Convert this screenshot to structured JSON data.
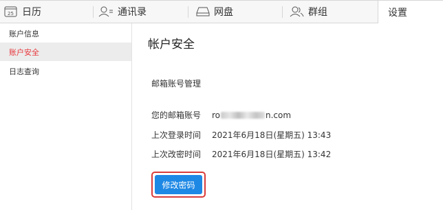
{
  "tabs": [
    {
      "label": "日历",
      "icon": "calendar-icon",
      "icon_text": "25"
    },
    {
      "label": "通讯录",
      "icon": "contacts-icon"
    },
    {
      "label": "网盘",
      "icon": "drive-icon"
    },
    {
      "label": "群组",
      "icon": "group-icon"
    },
    {
      "label": "设置",
      "active": true
    }
  ],
  "sidebar": {
    "items": [
      {
        "label": "账户信息"
      },
      {
        "label": "账户安全",
        "active": true
      },
      {
        "label": "日志查询"
      }
    ]
  },
  "main": {
    "title": "帐户安全",
    "section_title": "邮箱账号管理",
    "email": {
      "label": "您的邮箱账号",
      "value_prefix": "ro",
      "value_suffix": "n.com"
    },
    "last_login": {
      "label": "上次登录时间",
      "value": "2021年6月18日(星期五) 13:43"
    },
    "last_password_change": {
      "label": "上次改密时间",
      "value": "2021年6月18日(星期五) 13:42"
    },
    "change_password_button": "修改密码"
  },
  "colors": {
    "accent_blue": "#1e88e5",
    "active_red": "#e8373c",
    "highlight_border": "#d93a3a"
  }
}
